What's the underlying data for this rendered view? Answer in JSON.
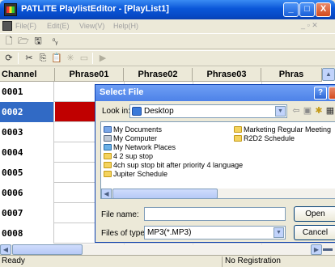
{
  "window": {
    "title": "PATLITE PlaylistEditor - [PlayList1]",
    "min": "_",
    "max": "□",
    "close": "X"
  },
  "menu": {
    "items": [
      "File(F)",
      "Edit(E)",
      "View(V)",
      "Help(H)"
    ],
    "right": "_ ▫ ✕"
  },
  "toolbar1": {
    "new": "🗋",
    "open": "🗁",
    "save": "🖫",
    "special": "⁰ᵧ"
  },
  "toolbar2": {
    "refresh": "⟳",
    "cut": "✂",
    "copy": "⎘",
    "paste": "📋",
    "delete": "✳",
    "view": "▭",
    "play": "▶"
  },
  "grid": {
    "columns": [
      "Channel",
      "Phrase01",
      "Phrase02",
      "Phrase03",
      "Phras"
    ],
    "rows": [
      {
        "channel": "0001"
      },
      {
        "channel": "0002"
      },
      {
        "channel": "0003"
      },
      {
        "channel": "0004"
      },
      {
        "channel": "0005"
      },
      {
        "channel": "0006"
      },
      {
        "channel": "0007"
      },
      {
        "channel": "0008"
      }
    ],
    "selected_row": "0002",
    "colors": {
      "selected": "#316ac5",
      "red_cell": "#c00000"
    }
  },
  "status": {
    "left": "Ready",
    "right": "No Registration"
  },
  "dialog": {
    "title": "Select File",
    "help": "?",
    "look_in_label": "Look in:",
    "look_in_value": "Desktop",
    "files": [
      {
        "name": "My Documents",
        "icon": "documents-icon"
      },
      {
        "name": "My Computer",
        "icon": "computer-icon"
      },
      {
        "name": "My Network Places",
        "icon": "network-icon"
      },
      {
        "name": "4 2 sup stop",
        "icon": "folder-icon"
      },
      {
        "name": "4ch sup stop bit after priority 4 language",
        "icon": "folder-icon"
      },
      {
        "name": "Jupiter Schedule",
        "icon": "folder-icon"
      },
      {
        "name": "Marketing Regular Meeting",
        "icon": "folder-icon"
      },
      {
        "name": "R2D2 Schedule",
        "icon": "folder-icon"
      }
    ],
    "file_name_label": "File name:",
    "file_name_value": "",
    "file_type_label": "Files of type:",
    "file_type_value": "MP3(*.MP3)",
    "open_label": "Open",
    "cancel_label": "Cancel"
  }
}
